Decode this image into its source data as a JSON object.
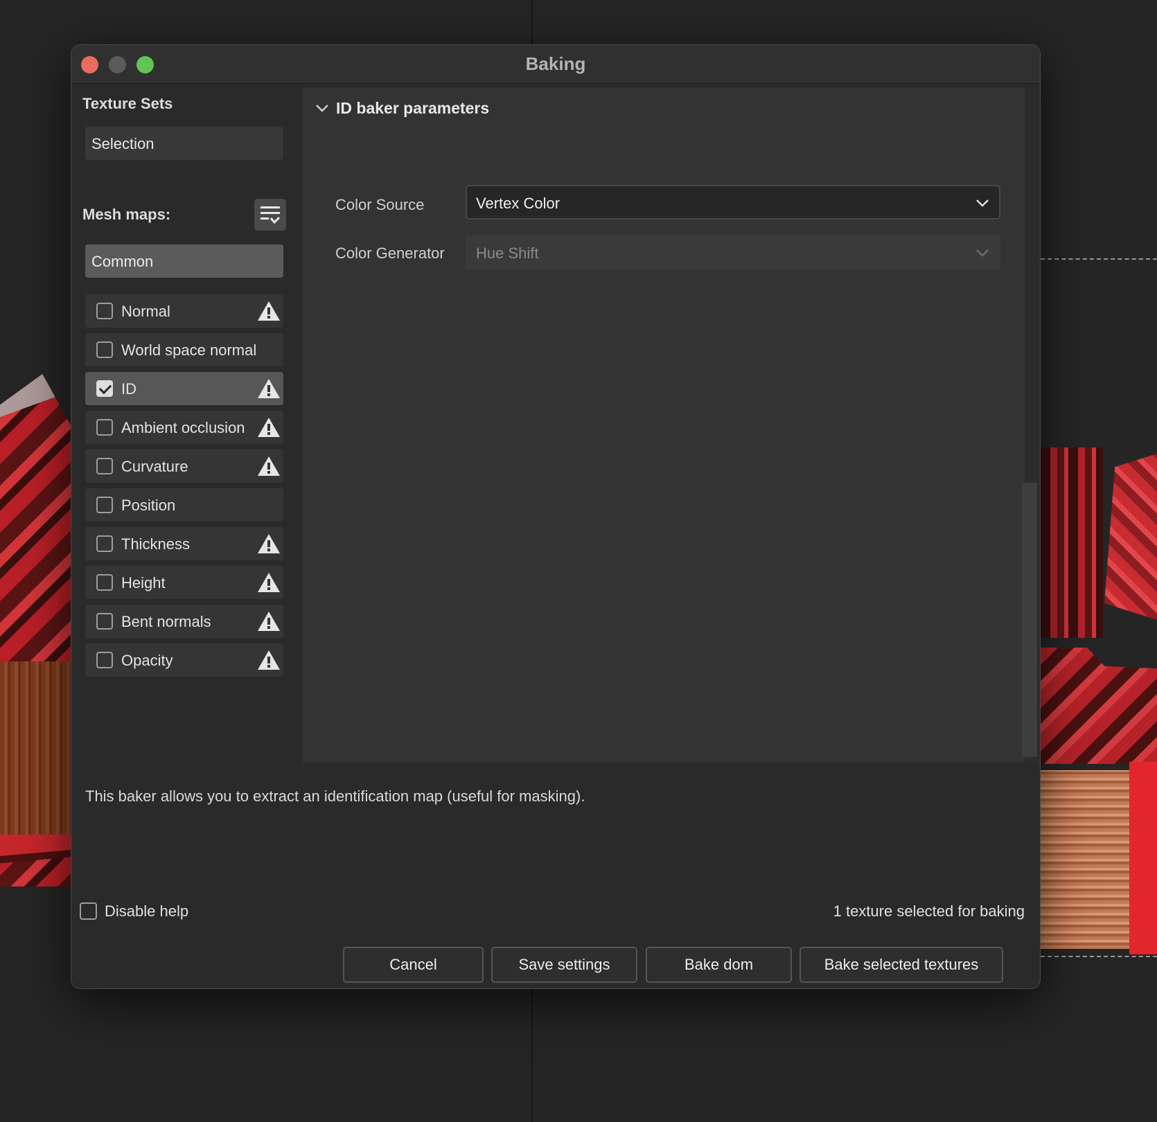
{
  "window": {
    "title": "Baking"
  },
  "texture_sets": {
    "heading": "Texture Sets",
    "selection_label": "Selection"
  },
  "mesh_maps": {
    "heading": "Mesh maps:",
    "menu_icon": "list-check-icon",
    "common_tab": "Common",
    "items": [
      {
        "label": "Normal",
        "checked": false,
        "warning": true
      },
      {
        "label": "World space normal",
        "checked": false,
        "warning": false
      },
      {
        "label": "ID",
        "checked": true,
        "warning": true
      },
      {
        "label": "Ambient occlusion",
        "checked": false,
        "warning": true
      },
      {
        "label": "Curvature",
        "checked": false,
        "warning": true
      },
      {
        "label": "Position",
        "checked": false,
        "warning": false
      },
      {
        "label": "Thickness",
        "checked": false,
        "warning": true
      },
      {
        "label": "Height",
        "checked": false,
        "warning": true
      },
      {
        "label": "Bent normals",
        "checked": false,
        "warning": true
      },
      {
        "label": "Opacity",
        "checked": false,
        "warning": true
      }
    ]
  },
  "params": {
    "title": "ID baker parameters",
    "color_source": {
      "label": "Color Source",
      "value": "Vertex Color"
    },
    "color_generator": {
      "label": "Color Generator",
      "value": "Hue Shift",
      "disabled": true
    }
  },
  "help_text": "This baker allows you to extract an identification map (useful for masking).",
  "footer": {
    "disable_help_label": "Disable help",
    "disable_help_checked": false,
    "status": "1 texture selected for baking",
    "buttons": {
      "cancel": "Cancel",
      "save": "Save settings",
      "bake_dom": "Bake dom",
      "bake_selected": "Bake selected textures"
    }
  },
  "colors": {
    "close": "#ed6a5e",
    "zoom": "#61c554",
    "texture_red": "#c0262b",
    "texture_dark": "#3a0d0d",
    "texture_wood": "#8a4a2a"
  }
}
